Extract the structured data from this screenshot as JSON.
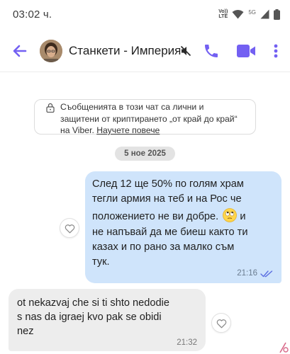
{
  "status_bar": {
    "time": "03:02 ч.",
    "volte_line1": "Vo))",
    "volte_line2": "LTE",
    "network": "5G",
    "icons": [
      "wifi-icon",
      "signal-icon",
      "battery-icon"
    ]
  },
  "header": {
    "chat_name": "Станкети - Империя",
    "icons": [
      "back-arrow-icon",
      "avatar",
      "muted-icon",
      "phone-icon",
      "video-icon",
      "more-vertical-icon"
    ]
  },
  "encryption_notice": {
    "line1": "Съобщенията в този чат са лични и",
    "line2": "защитени от криптирането „от край до край“",
    "line3_prefix": "на Viber. ",
    "learn_more": "Научете повече"
  },
  "date_separator": "5 ное 2025",
  "messages": [
    {
      "direction": "outgoing",
      "lines": [
        "След 12 ще 50% по голям храм",
        "тегли армия на теб и на Рос че",
        "положението не ви добре.",
        "и",
        "не напъвай да ме биеш както ти",
        "казах и по рано за малко съм",
        "тук."
      ],
      "emoji": "rolling-eyes-emoji",
      "time": "21:16",
      "status": "seen"
    },
    {
      "direction": "incoming",
      "lines": [
        "ot nekazvaj che si ti shto nedodie",
        "s nas da igraej kvo pak se obidi",
        "nez"
      ],
      "time": "21:32"
    }
  ],
  "colors": {
    "accent": "#7360f2",
    "outgoing_bubble": "#cfe4fb",
    "incoming_bubble": "#ededed",
    "seen_ticks": "#5b6ee1"
  }
}
